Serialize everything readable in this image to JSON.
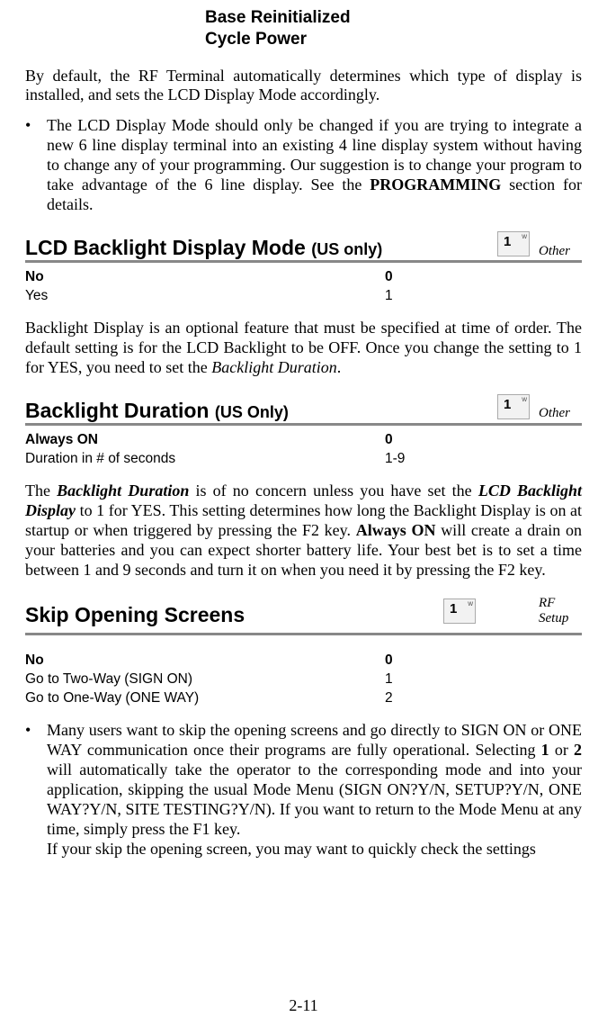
{
  "title_block": {
    "line1": "Base Reinitialized",
    "line2": "Cycle Power"
  },
  "intro_para": "By default, the RF Terminal automatically determines which type of display is installed, and sets the LCD Display Mode accordingly.",
  "bullet1": {
    "pre": "The LCD Display Mode should only be changed if you are trying to integrate a new 6 line display terminal into an existing 4 line display system without having to change any of your programming. Our suggestion is to change your program to take advantage of the 6 line display. See the ",
    "bold": "PROGRAMMING",
    "post": " section for details."
  },
  "sec1": {
    "title": "LCD Backlight Display Mode ",
    "sub": "(US only)",
    "cat": "Other",
    "key_digit": "1",
    "key_letter": "w",
    "options": [
      {
        "label": "No",
        "value": "0",
        "default": true
      },
      {
        "label": "Yes",
        "value": "1",
        "default": false
      }
    ],
    "para_pre": "Backlight Display is an optional feature that must be specified at time of order. The default setting is for the LCD Backlight to be OFF.  Once you change the setting to 1 for YES, you need to set the ",
    "para_em": "Backlight Duration",
    "para_post": "."
  },
  "sec2": {
    "title": "Backlight Duration ",
    "sub": "(US Only)",
    "cat": "Other",
    "key_digit": "1",
    "key_letter": "w",
    "options": [
      {
        "label": "Always ON",
        "value": "0",
        "default": true
      },
      {
        "label": "Duration in # of seconds",
        "value": "1-9",
        "default": false
      }
    ],
    "para_pre": "The ",
    "para_em1": "Backlight Duration",
    "para_mid1": " is of no concern unless you have set the ",
    "para_em2": "LCD Backlight Display",
    "para_mid2": " to 1 for YES. This setting determines how long the Backlight Display is on at startup or when triggered by pressing the F2 key.  ",
    "para_bold": "Always ON",
    "para_post": " will create a drain on your batteries and you can expect shorter battery life. Your best bet is to set a time between 1 and 9 seconds and turn it on when you need it by pressing the F2 key."
  },
  "sec3": {
    "title": "Skip Opening Screens",
    "cat_line1": "RF",
    "cat_line2": "Setup",
    "key_digit": "1",
    "key_letter": "w",
    "options": [
      {
        "label": "No",
        "value": "0",
        "default": true
      },
      {
        "label": "Go to Two-Way (SIGN ON)",
        "value": "1",
        "default": false
      },
      {
        "label": "Go to One-Way (ONE WAY)",
        "value": "2",
        "default": false
      }
    ],
    "bullet": {
      "pre": "Many users want to skip the opening screens and go directly to SIGN ON or ONE WAY communication once their programs are fully operational. Selecting ",
      "b1": "1",
      "mid1": " or ",
      "b2": "2",
      "post": " will automatically take the operator to the corresponding mode and into your application, skipping the usual Mode Menu (SIGN ON?Y/N, SETUP?Y/N, ONE WAY?Y/N, SITE TESTING?Y/N). If you want to return to the Mode Menu at any time, simply press the F1 key."
    },
    "trailing": "If your skip the opening screen, you may want to quickly check the settings"
  },
  "page_number": "2-11"
}
